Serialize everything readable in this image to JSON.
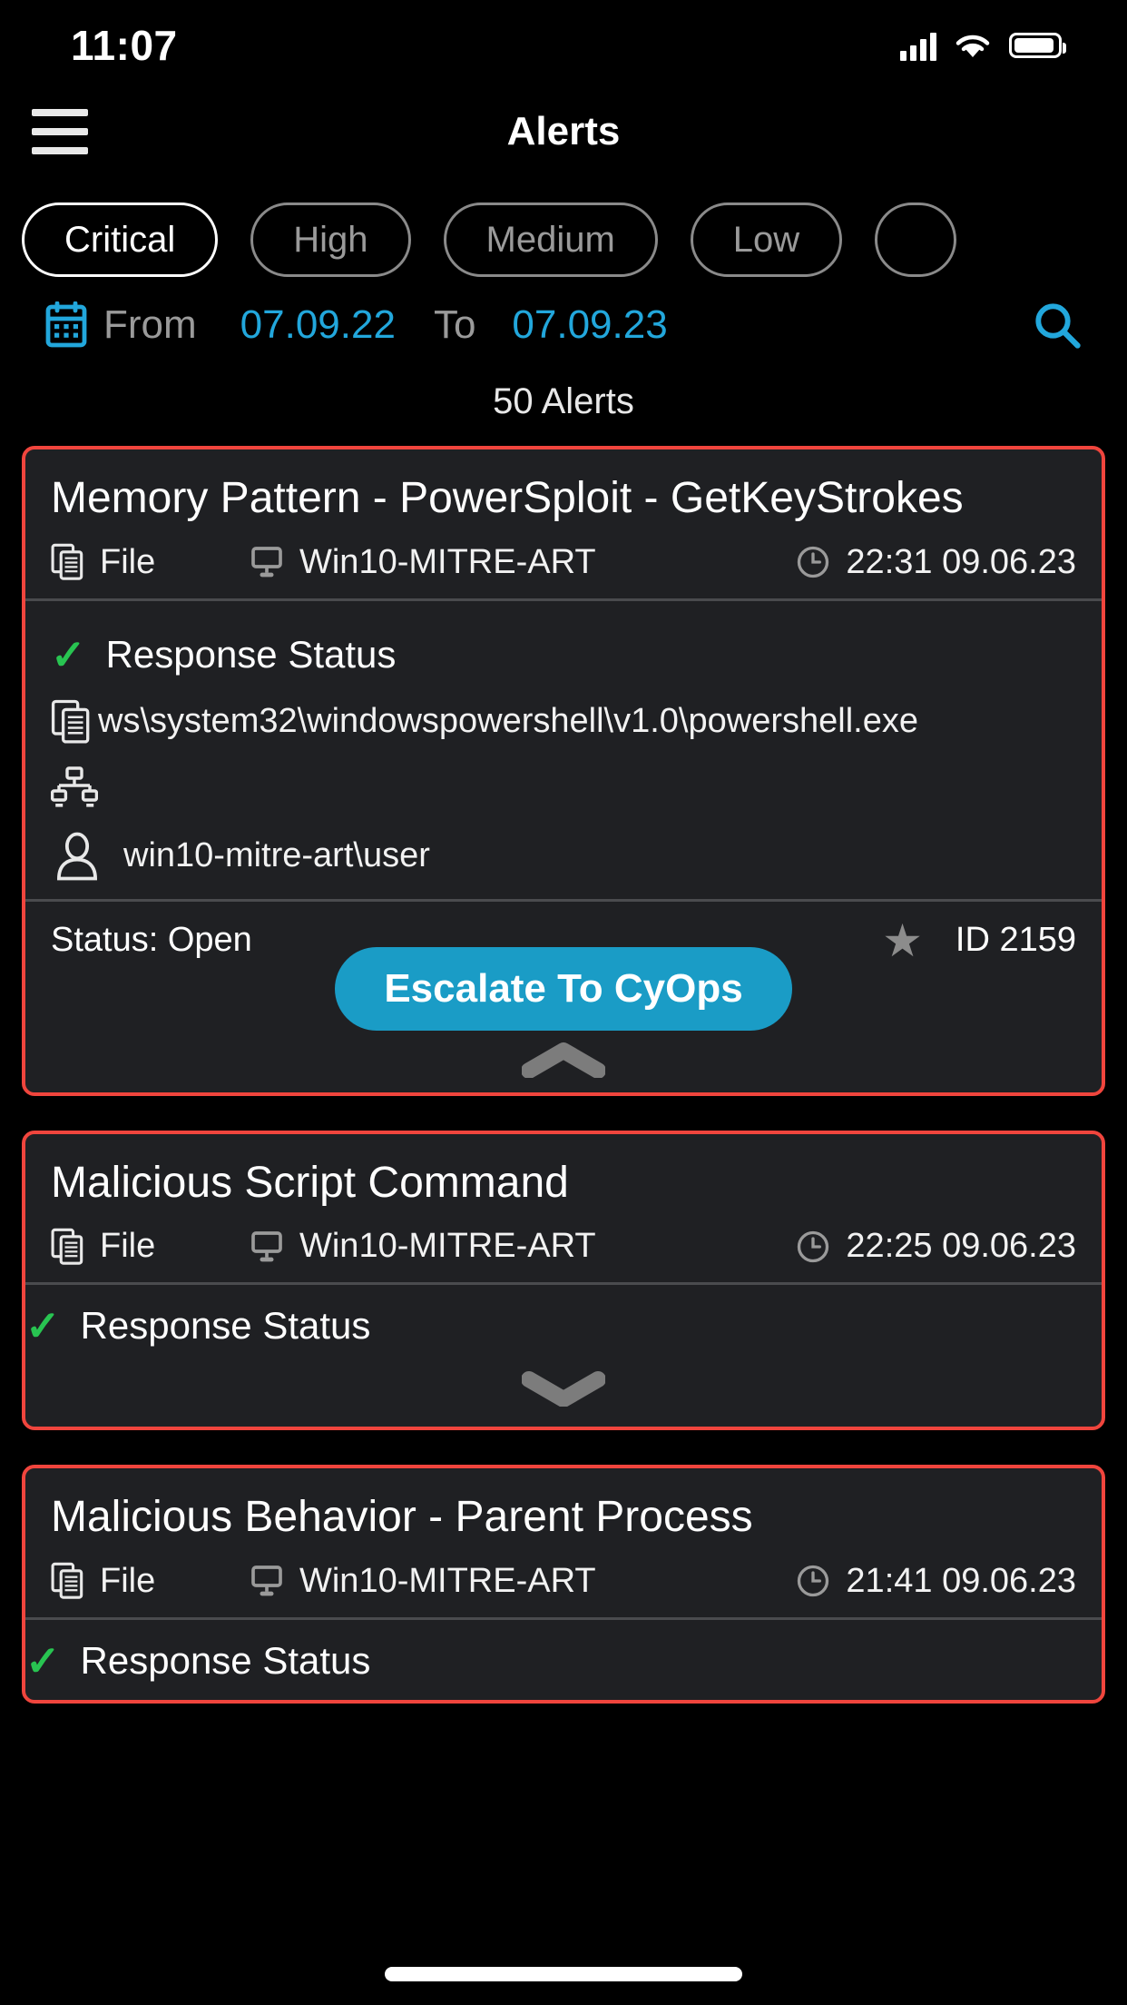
{
  "status_bar": {
    "time": "11:07",
    "cellular_icon": "cellular-signal-icon",
    "wifi_icon": "wifi-icon",
    "battery_icon": "battery-icon"
  },
  "nav": {
    "menu_icon": "hamburger-menu-icon",
    "title": "Alerts"
  },
  "severity_filters": {
    "chips": [
      {
        "label": "Critical",
        "selected": true
      },
      {
        "label": "High",
        "selected": false
      },
      {
        "label": "Medium",
        "selected": false
      },
      {
        "label": "Low",
        "selected": false
      },
      {
        "label": "",
        "selected": false
      }
    ]
  },
  "date_filter": {
    "calendar_icon": "calendar-icon",
    "from_label": "From",
    "from_value": "07.09.22",
    "to_label": "To",
    "to_value": "07.09.23",
    "search_icon": "search-icon"
  },
  "results": {
    "count_label": "50 Alerts"
  },
  "colors": {
    "accent_cyan": "#1a9cc6",
    "critical_red": "#f0453d",
    "success_green": "#28c451",
    "card_bg": "#1f2023",
    "page_bg": "#000000",
    "muted_text": "#9a9a9a"
  },
  "alerts": [
    {
      "title": "Memory Pattern - PowerSploit - GetKeyStrokes",
      "type_icon": "file-copy-icon",
      "type_label": "File",
      "host_icon": "desktop-monitor-icon",
      "host_label": "Win10-MITRE-ART",
      "time_icon": "clock-icon",
      "time_label": "22:31 09.06.23",
      "expanded": true,
      "response_status_label": "Response Status",
      "response_status_icon": "green-check-icon",
      "details": [
        {
          "icon": "file-copy-icon",
          "value": "ws\\system32\\windowspowershell\\v1.0\\powershell.exe"
        },
        {
          "icon": "network-topology-icon",
          "value": ""
        },
        {
          "icon": "user-person-icon",
          "value": "win10-mitre-art\\user"
        }
      ],
      "status_label": "Status: Open",
      "star_icon": "star-icon",
      "id_label": "ID 2159",
      "escalate_button": "Escalate To CyOps",
      "collapse_icon": "chevron-up-icon"
    },
    {
      "title": "Malicious Script Command",
      "type_icon": "file-copy-icon",
      "type_label": "File",
      "host_icon": "desktop-monitor-icon",
      "host_label": "Win10-MITRE-ART",
      "time_icon": "clock-icon",
      "time_label": "22:25 09.06.23",
      "expanded": false,
      "response_status_label": "Response Status",
      "response_status_icon": "green-check-icon",
      "expand_icon": "chevron-down-icon"
    },
    {
      "title": "Malicious Behavior - Parent Process",
      "type_icon": "file-copy-icon",
      "type_label": "File",
      "host_icon": "desktop-monitor-icon",
      "host_label": "Win10-MITRE-ART",
      "time_icon": "clock-icon",
      "time_label": "21:41 09.06.23",
      "expanded": false,
      "response_status_label": "Response Status",
      "response_status_icon": "green-check-icon"
    }
  ],
  "home_indicator": "home-indicator"
}
